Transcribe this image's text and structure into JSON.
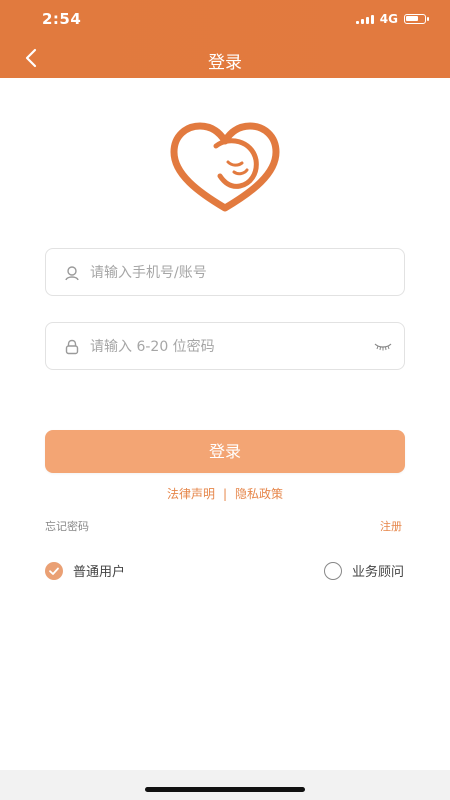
{
  "status_bar": {
    "time": "2:54",
    "network": "4G",
    "battery_level": 0.7
  },
  "header": {
    "title": "登录"
  },
  "form": {
    "account_placeholder": "请输入手机号/账号",
    "account_value": "",
    "password_placeholder": "请输入 6-20 位密码",
    "password_value": ""
  },
  "login_button": {
    "label": "登录"
  },
  "legal": {
    "law_label": "法律声明",
    "separator": "|",
    "privacy_label": "隐私政策"
  },
  "forgot_label": "忘记密码",
  "register_label": "注册",
  "roles": [
    {
      "label": "普通用户",
      "selected": true
    },
    {
      "label": "业务顾问",
      "selected": false
    }
  ],
  "colors": {
    "brand": "#e17a3e",
    "button": "#f3a574",
    "link": "#e6864a"
  },
  "icons": {
    "back": "chevron-left-icon",
    "account": "user-icon",
    "password": "lock-icon",
    "visibility": "eye-closed-icon"
  }
}
